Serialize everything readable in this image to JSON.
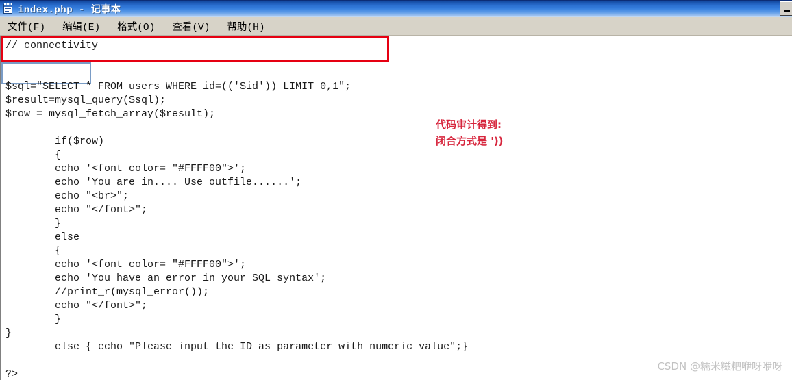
{
  "window": {
    "title": "index.php - 记事本",
    "icon": "notepad-icon",
    "controls": {
      "minimize_label": ""
    }
  },
  "menu": {
    "items": [
      {
        "label": "文件(F)"
      },
      {
        "label": "编辑(E)"
      },
      {
        "label": "格式(O)"
      },
      {
        "label": "查看(V)"
      },
      {
        "label": "帮助(H)"
      }
    ]
  },
  "editor": {
    "code_lines": [
      "// connectivity",
      "",
      "",
      "$sql=\"SELECT * FROM users WHERE id=(('$id')) LIMIT 0,1\";",
      "$result=mysql_query($sql);",
      "$row = mysql_fetch_array($result);",
      "",
      "        if($row)",
      "        {",
      "        echo '<font color= \"#FFFF00\">';",
      "        echo 'You are in.... Use outfile......';",
      "        echo \"<br>\";",
      "        echo \"</font>\";",
      "        }",
      "        else",
      "        {",
      "        echo '<font color= \"#FFFF00\">';",
      "        echo 'You have an error in your SQL syntax';",
      "        //print_r(mysql_error());",
      "        echo \"</font>\";",
      "        }",
      "}",
      "        else { echo \"Please input the ID as parameter with numeric value\";}",
      "",
      "?>"
    ]
  },
  "annotations": {
    "red_box": {
      "label": "sql-statement-highlight",
      "color": "#e60012"
    },
    "blue_box": {
      "label": "injection-point-highlight",
      "color": "#7a9cc6"
    },
    "note": {
      "color": "#d7263d",
      "lines": [
        "代码审计得到:",
        "闭合方式是 '))"
      ]
    }
  },
  "watermark": {
    "text": "CSDN @糯米糍粑咿呀咿呀"
  }
}
